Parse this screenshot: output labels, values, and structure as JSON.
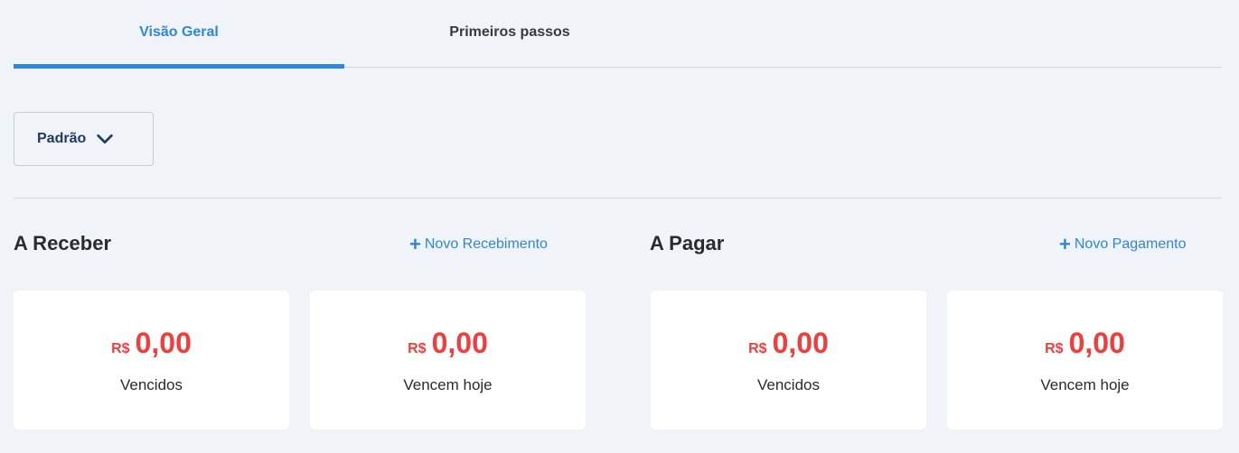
{
  "tabs": [
    {
      "label": "Visão Geral"
    },
    {
      "label": "Primeiros passos"
    }
  ],
  "filter": {
    "label": "Padrão",
    "icon": "chevron-down-icon"
  },
  "receber": {
    "title": "A Receber",
    "action": "Novo Recebimento",
    "cards": [
      {
        "currency": "R$",
        "value": "0,00",
        "label": "Vencidos"
      },
      {
        "currency": "R$",
        "value": "0,00",
        "label": "Vencem hoje"
      }
    ]
  },
  "pagar": {
    "title": "A Pagar",
    "action": "Novo Pagamento",
    "cards": [
      {
        "currency": "R$",
        "value": "0,00",
        "label": "Vencidos"
      },
      {
        "currency": "R$",
        "value": "0,00",
        "label": "Vencem hoje"
      }
    ]
  },
  "colors": {
    "accent": "#2f86de",
    "negative": "#f23d3d",
    "background": "#f0f3f8"
  }
}
